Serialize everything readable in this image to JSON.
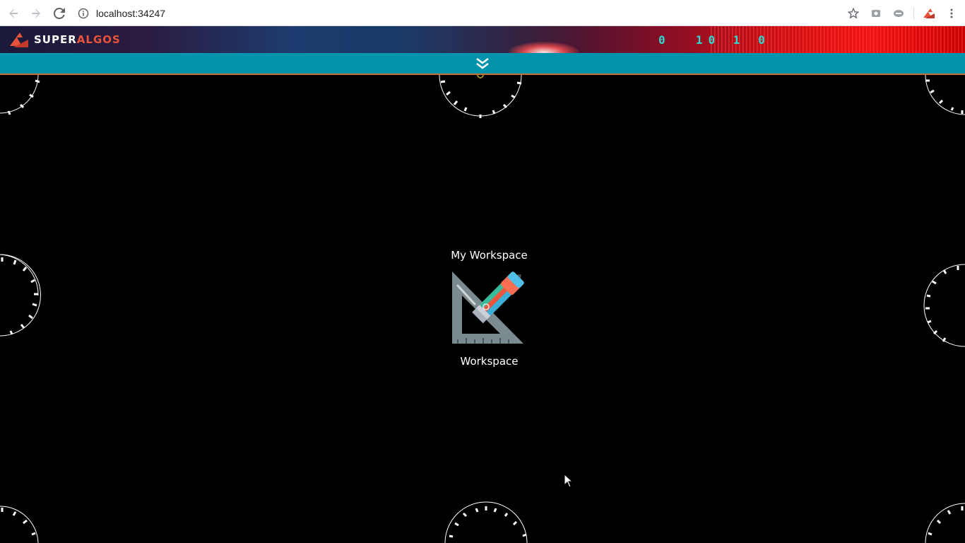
{
  "browser": {
    "url": "localhost:34247"
  },
  "app": {
    "logo_part1": "SUPER",
    "logo_part2": "ALGOS",
    "banner_binary": "0  10 1 0"
  },
  "workspace": {
    "node_title": "My Workspace",
    "node_type": "Workspace",
    "icon": "workspace-icon"
  },
  "colors": {
    "toolbar": "#0293ad",
    "toolbar_border": "#c8702d",
    "canvas": "#000000",
    "brand_accent": "#e8533a"
  }
}
